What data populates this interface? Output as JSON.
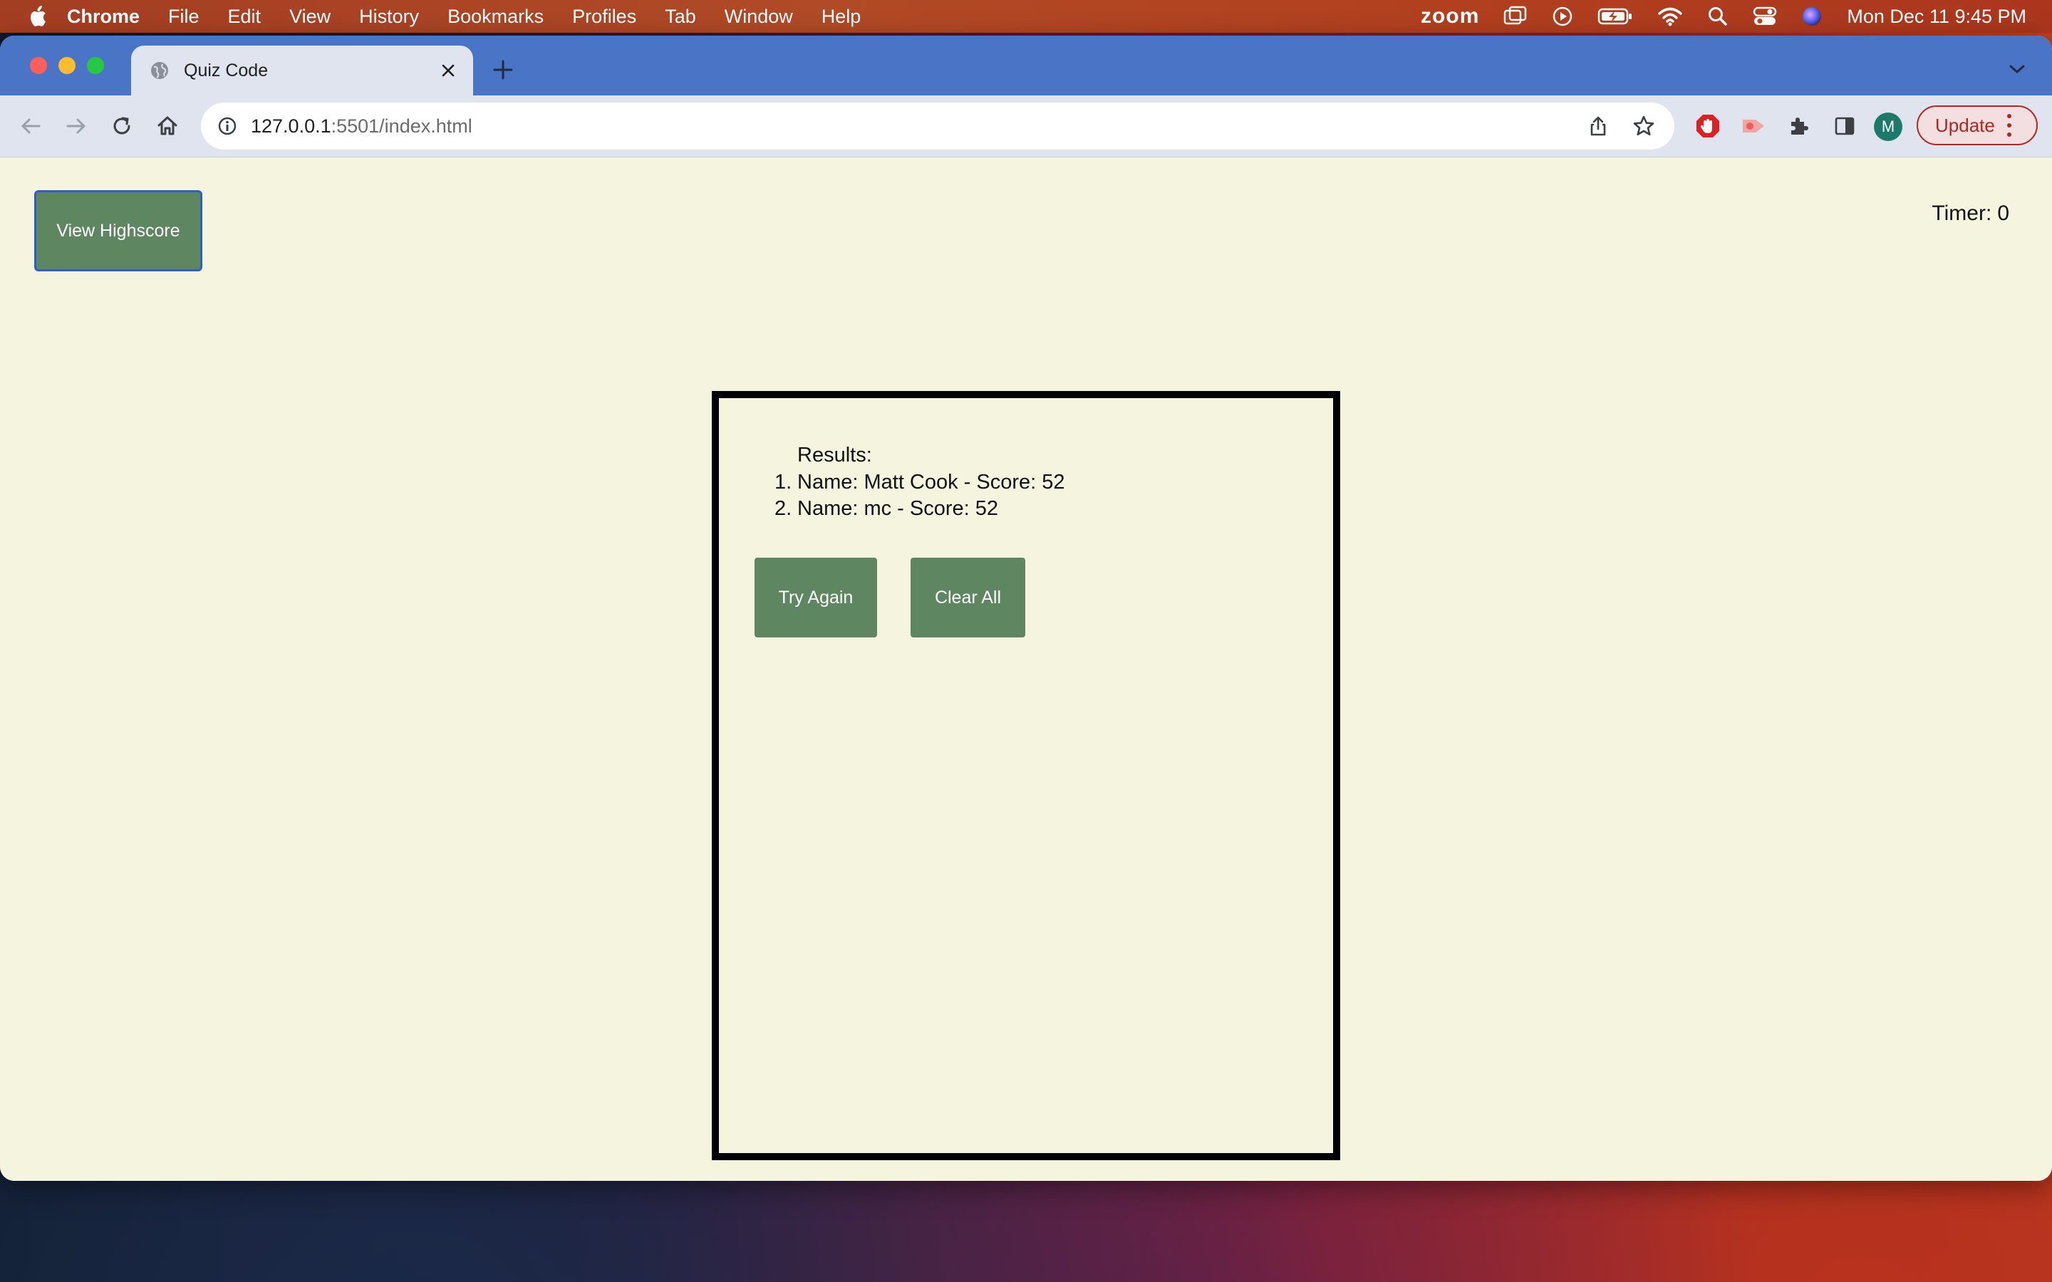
{
  "menubar": {
    "app_name": "Chrome",
    "items": [
      "File",
      "Edit",
      "View",
      "History",
      "Bookmarks",
      "Profiles",
      "Tab",
      "Window",
      "Help"
    ],
    "zoom_label": "zoom",
    "clock": "Mon Dec 11  9:45 PM"
  },
  "browser": {
    "tab_title": "Quiz Code",
    "url_host": "127.0.0.1",
    "url_rest": ":5501/index.html",
    "profile_initial": "M",
    "update_label": "Update"
  },
  "page": {
    "highscore_button": "View Highscore",
    "timer_label": "Timer:",
    "timer_value": "0",
    "results_title": "Results:",
    "results": [
      {
        "num": "1.",
        "text": "Name: Matt Cook - Score: 52"
      },
      {
        "num": "2.",
        "text": "Name: mc - Score: 52"
      }
    ],
    "try_again_label": "Try Again",
    "clear_all_label": "Clear All"
  },
  "colors": {
    "page_bg": "#f5f5df",
    "button_green": "#5e8660",
    "tabbar_blue": "#4a74c6",
    "update_red": "#b3261e"
  }
}
